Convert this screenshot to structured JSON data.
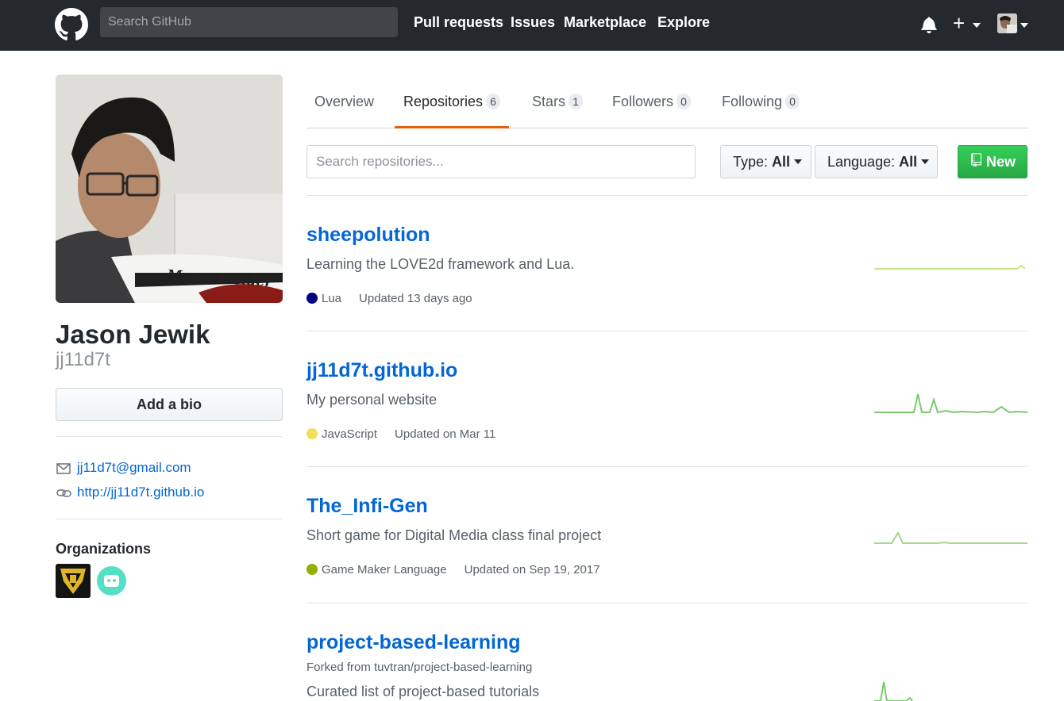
{
  "header": {
    "search_placeholder": "Search GitHub",
    "nav": [
      "Pull requests",
      "Issues",
      "Marketplace",
      "Explore"
    ],
    "plus_label": "+"
  },
  "profile": {
    "photo_caption": "Meme Insider",
    "full_name": "Jason Jewik",
    "username": "jj11d7t",
    "add_bio_label": "Add a bio",
    "email": "jj11d7t@gmail.com",
    "website": "http://jj11d7t.github.io",
    "organizations_title": "Organizations"
  },
  "tabs": [
    {
      "label": "Overview"
    },
    {
      "label": "Repositories",
      "count": "6"
    },
    {
      "label": "Stars",
      "count": "1"
    },
    {
      "label": "Followers",
      "count": "0"
    },
    {
      "label": "Following",
      "count": "0"
    }
  ],
  "filters": {
    "search_placeholder": "Search repositories...",
    "type_label": "Type:",
    "type_value": "All",
    "language_label": "Language:",
    "language_value": "All",
    "new_label": "New"
  },
  "repos": [
    {
      "name": "sheepolution",
      "description": "Learning the LOVE2d framework and Lua.",
      "language": "Lua",
      "language_color": "#000080",
      "updated": "Updated 13 days ago"
    },
    {
      "name": "jj11d7t.github.io",
      "description": "My personal website",
      "language": "JavaScript",
      "language_color": "#f1e05a",
      "updated": "Updated on Mar 11"
    },
    {
      "name": "The_Infi-Gen",
      "description": "Short game for Digital Media class final project",
      "language": "Game Maker Language",
      "language_color": "#8fb200",
      "updated": "Updated on Sep 19, 2017"
    },
    {
      "name": "project-based-learning",
      "forked_from": "Forked from tuvtran/project-based-learning",
      "description": "Curated list of project-based tutorials"
    }
  ],
  "colors": {
    "header_bg": "#24292e",
    "link": "#0366d6",
    "active_tab_accent": "#e36209",
    "new_button": "#28a745",
    "sparkline": "#9be9a8"
  }
}
